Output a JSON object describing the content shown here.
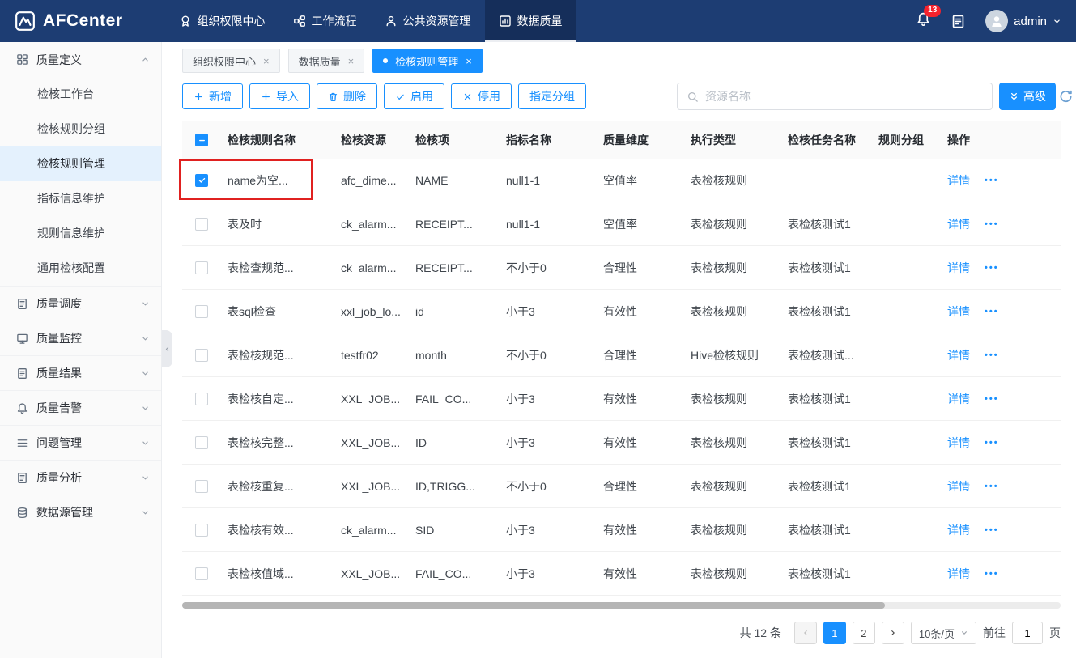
{
  "colors": {
    "accent": "#1890ff",
    "topbar_bg": "#1d3d73",
    "badge_red": "#f5222d",
    "annotation_red": "#e02120",
    "active_item_bg": "#e4f1fd"
  },
  "topbar": {
    "logo_text": "AFCenter",
    "nav": [
      {
        "label": "组织权限中心",
        "icon": "badge-icon",
        "active": false
      },
      {
        "label": "工作流程",
        "icon": "workflow-icon",
        "active": false
      },
      {
        "label": "公共资源管理",
        "icon": "people-icon",
        "active": false
      },
      {
        "label": "数据质量",
        "icon": "chart-icon",
        "active": true
      }
    ],
    "notification_count": "13",
    "username": "admin"
  },
  "sidebar": {
    "groups": [
      {
        "label": "质量定义",
        "icon": "category-icon",
        "expanded": true,
        "children": [
          {
            "label": "检核工作台",
            "active": false
          },
          {
            "label": "检核规则分组",
            "active": false
          },
          {
            "label": "检核规则管理",
            "active": true
          },
          {
            "label": "指标信息维护",
            "active": false
          },
          {
            "label": "规则信息维护",
            "active": false
          },
          {
            "label": "通用检核配置",
            "active": false
          }
        ]
      },
      {
        "label": "质量调度",
        "icon": "document-icon",
        "expanded": false
      },
      {
        "label": "质量监控",
        "icon": "monitor-icon",
        "expanded": false
      },
      {
        "label": "质量结果",
        "icon": "document-icon",
        "expanded": false
      },
      {
        "label": "质量告警",
        "icon": "bell-icon",
        "expanded": false
      },
      {
        "label": "问题管理",
        "icon": "list-icon",
        "expanded": false
      },
      {
        "label": "质量分析",
        "icon": "document-icon",
        "expanded": false
      },
      {
        "label": "数据源管理",
        "icon": "database-icon",
        "expanded": false
      }
    ]
  },
  "tabs": [
    {
      "label": "组织权限中心",
      "active": false
    },
    {
      "label": "数据质量",
      "active": false
    },
    {
      "label": "检核规则管理",
      "active": true
    }
  ],
  "toolbar": {
    "buttons": [
      {
        "label": "新增",
        "icon": "plus-icon"
      },
      {
        "label": "导入",
        "icon": "plus-icon"
      },
      {
        "label": "删除",
        "icon": "trash-icon"
      },
      {
        "label": "启用",
        "icon": "check-icon"
      },
      {
        "label": "停用",
        "icon": "close-icon"
      },
      {
        "label": "指定分组",
        "icon": ""
      }
    ],
    "search_placeholder": "资源名称",
    "advanced_label": "高级"
  },
  "table": {
    "headers": [
      "检核规则名称",
      "检核资源",
      "检核项",
      "指标名称",
      "质量维度",
      "执行类型",
      "检核任务名称",
      "规则分组",
      "操作"
    ],
    "detail_label": "详情",
    "more_icon": "•••",
    "rows": [
      {
        "checked": true,
        "annotated": true,
        "name": "name为空...",
        "resource": "afc_dime...",
        "item": "NAME",
        "metric": "null1-1",
        "dimension": "空值率",
        "exec_type": "表检核规则",
        "task": "",
        "group": ""
      },
      {
        "checked": false,
        "name": "表及时",
        "resource": "ck_alarm...",
        "item": "RECEIPT...",
        "metric": "null1-1",
        "dimension": "空值率",
        "exec_type": "表检核规则",
        "task": "表检核测试1",
        "group": ""
      },
      {
        "checked": false,
        "name": "表检查规范...",
        "resource": "ck_alarm...",
        "item": "RECEIPT...",
        "metric": "不小于0",
        "dimension": "合理性",
        "exec_type": "表检核规则",
        "task": "表检核测试1",
        "group": ""
      },
      {
        "checked": false,
        "name": "表sql检查",
        "resource": "xxl_job_lo...",
        "item": "id",
        "metric": "小于3",
        "dimension": "有效性",
        "exec_type": "表检核规则",
        "task": "表检核测试1",
        "group": ""
      },
      {
        "checked": false,
        "name": "表检核规范...",
        "resource": "testfr02",
        "item": "month",
        "metric": "不小于0",
        "dimension": "合理性",
        "exec_type": "Hive检核规则",
        "task": "表检核测试...",
        "group": ""
      },
      {
        "checked": false,
        "name": "表检核自定...",
        "resource": "XXL_JOB...",
        "item": "FAIL_CO...",
        "metric": "小于3",
        "dimension": "有效性",
        "exec_type": "表检核规则",
        "task": "表检核测试1",
        "group": ""
      },
      {
        "checked": false,
        "name": "表检核完整...",
        "resource": "XXL_JOB...",
        "item": "ID",
        "metric": "小于3",
        "dimension": "有效性",
        "exec_type": "表检核规则",
        "task": "表检核测试1",
        "group": ""
      },
      {
        "checked": false,
        "name": "表检核重复...",
        "resource": "XXL_JOB...",
        "item": "ID,TRIGG...",
        "metric": "不小于0",
        "dimension": "合理性",
        "exec_type": "表检核规则",
        "task": "表检核测试1",
        "group": ""
      },
      {
        "checked": false,
        "name": "表检核有效...",
        "resource": "ck_alarm...",
        "item": "SID",
        "metric": "小于3",
        "dimension": "有效性",
        "exec_type": "表检核规则",
        "task": "表检核测试1",
        "group": ""
      },
      {
        "checked": false,
        "name": "表检核值域...",
        "resource": "XXL_JOB...",
        "item": "FAIL_CO...",
        "metric": "小于3",
        "dimension": "有效性",
        "exec_type": "表检核规则",
        "task": "表检核测试1",
        "group": ""
      }
    ]
  },
  "pagination": {
    "total": "共 12 条",
    "pages": [
      "1",
      "2"
    ],
    "active_page": "1",
    "page_size": "10条/页",
    "goto_label": "前往",
    "goto_value": "1",
    "page_unit": "页"
  }
}
